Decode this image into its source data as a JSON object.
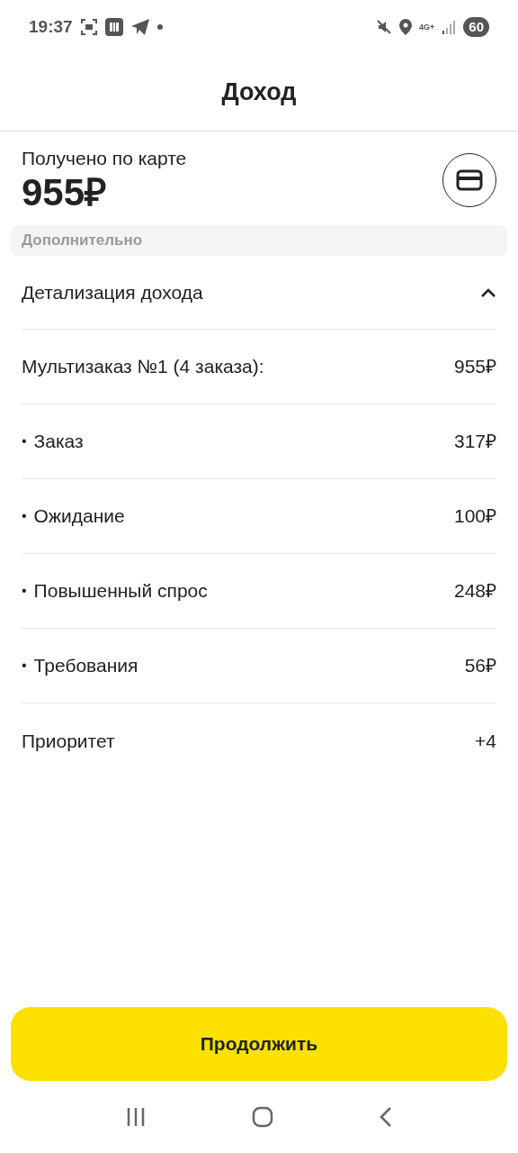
{
  "status_bar": {
    "time": "19:37",
    "battery": "60",
    "network": "4G+"
  },
  "header": {
    "title": "Доход"
  },
  "summary": {
    "label": "Получено по карте",
    "amount": "955₽"
  },
  "section_label": "Дополнительно",
  "details": {
    "title": "Детализация дохода",
    "expanded": true,
    "rows": [
      {
        "kind": "total",
        "label": "Мультизаказ №1 (4 заказа):",
        "value": "955₽"
      },
      {
        "kind": "item",
        "bullet": "•",
        "label": "Заказ",
        "value": "317₽"
      },
      {
        "kind": "item",
        "bullet": "•",
        "label": "Ожидание",
        "value": "100₽"
      },
      {
        "kind": "item",
        "bullet": "•",
        "label": "Повышенный спрос",
        "value": "248₽"
      },
      {
        "kind": "item",
        "bullet": "•",
        "label": "Требования",
        "value": "56₽"
      },
      {
        "kind": "extra",
        "label": "Приоритет",
        "value": "+4"
      }
    ]
  },
  "continue_button": "Продолжить"
}
